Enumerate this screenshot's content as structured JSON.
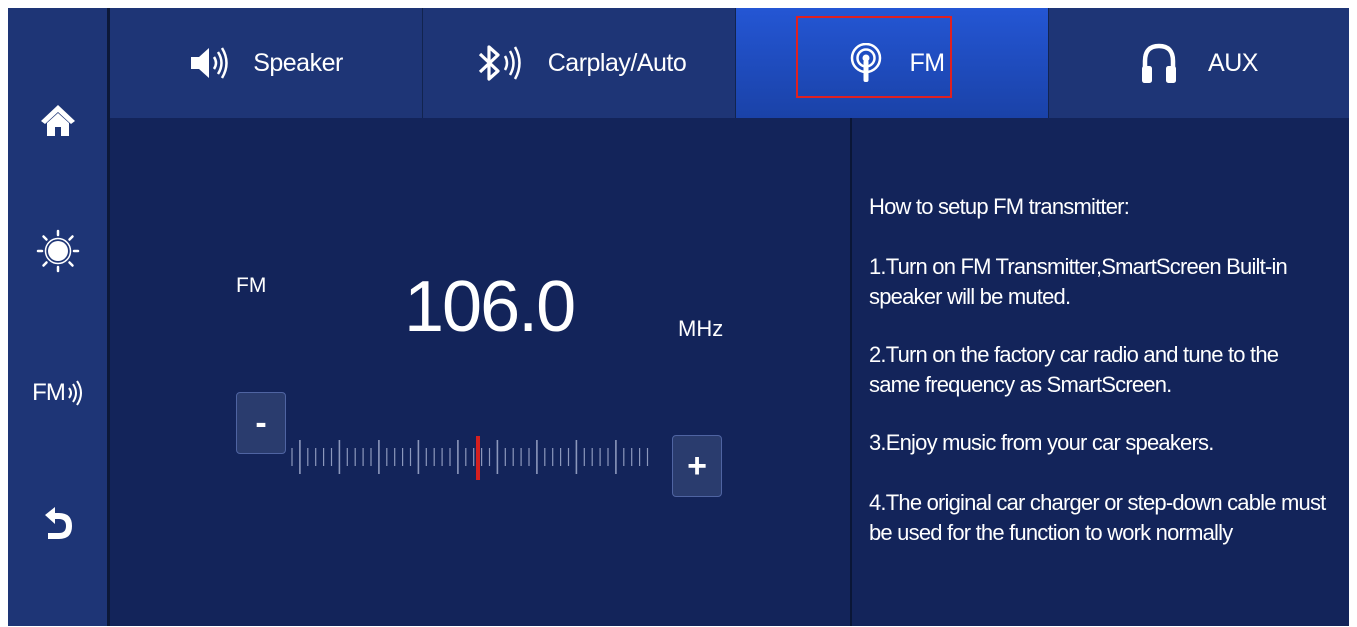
{
  "tabs": [
    {
      "label": "Speaker",
      "icon": "speaker-icon",
      "active": false
    },
    {
      "label": "Carplay/Auto",
      "icon": "bluetooth-icon",
      "active": false
    },
    {
      "label": "FM",
      "icon": "radio-antenna-icon",
      "active": true
    },
    {
      "label": "AUX",
      "icon": "headphones-icon",
      "active": false
    }
  ],
  "sidebar": {
    "items": [
      {
        "icon": "home-icon"
      },
      {
        "icon": "brightness-icon"
      },
      {
        "icon": "fm-icon",
        "label": "FM"
      },
      {
        "icon": "back-icon"
      }
    ]
  },
  "tuner": {
    "band": "FM",
    "frequency": "106.0",
    "unit": "MHz",
    "minus_label": "-",
    "plus_label": "+"
  },
  "info": {
    "title": "How to setup FM transmitter:",
    "steps": [
      "1.Turn on FM Transmitter,SmartScreen Built-in speaker will be muted.",
      "2.Turn on the factory car radio and tune to the same frequency as SmartScreen.",
      "3.Enjoy music from your car speakers.",
      "4.The original car charger or step-down cable must be used for the function to work normally"
    ]
  },
  "colors": {
    "background": "#13245a",
    "bar": "#1e3576",
    "active_tab": "#2456d4",
    "highlight": "#e02020",
    "indicator": "#d42020"
  }
}
